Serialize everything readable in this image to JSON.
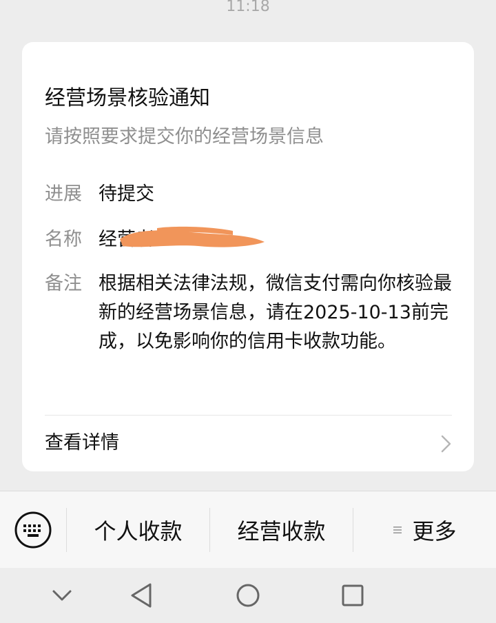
{
  "status_time": "11:18",
  "card": {
    "title": "经营场景核验通知",
    "subtitle": "请按照要求提交你的经营场景信息",
    "fields": [
      {
        "label": "进展",
        "value": "待提交"
      },
      {
        "label": "名称",
        "value": "经营者"
      },
      {
        "label": "备注",
        "value": "根据相关法律法规，微信支付需向你核验最新的经营场景信息，请在2025-10-13前完成，以免影响你的信用卡收款功能。"
      }
    ],
    "details_label": "查看详情"
  },
  "menu": {
    "items": [
      {
        "label": "个人收款"
      },
      {
        "label": "经营收款"
      },
      {
        "label": "更多"
      }
    ]
  },
  "colors": {
    "background": "#ededed",
    "card": "#ffffff",
    "secondary_text": "#8f8f8f",
    "redaction": "#f1955a"
  },
  "icons": {
    "keyboard": "keyboard-icon",
    "details": "chevron-right-icon",
    "more": "menu-lines-icon",
    "nav": [
      "chevron-down-icon",
      "back-triangle-icon",
      "home-circle-icon",
      "recents-square-icon"
    ]
  }
}
